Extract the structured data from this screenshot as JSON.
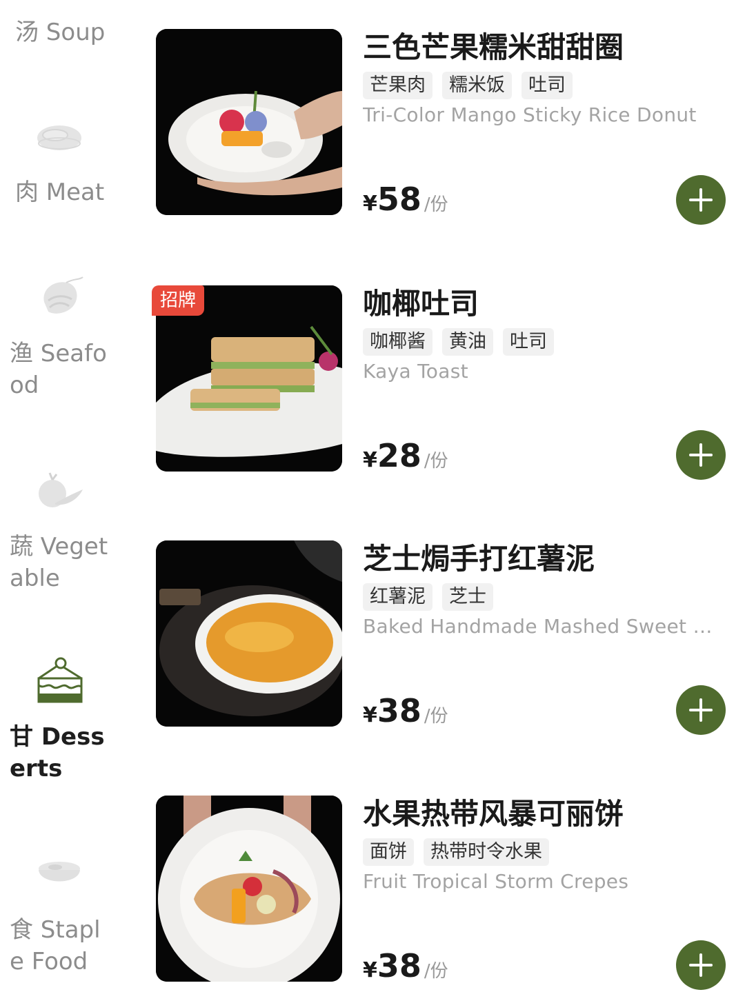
{
  "sidebar": {
    "categories": [
      {
        "label": "汤 Soup",
        "icon": "soup-icon",
        "active": false
      },
      {
        "label": "肉 Meat",
        "icon": "steak-icon",
        "active": false
      },
      {
        "label": "渔 Seafood",
        "icon": "shrimp-icon",
        "active": false
      },
      {
        "label": "蔬 Vegetable",
        "icon": "vegetable-icon",
        "active": false
      },
      {
        "label": "甘 Desserts",
        "icon": "cake-icon",
        "active": true
      },
      {
        "label": "食 Staple Food",
        "icon": "bowl-icon",
        "active": false
      }
    ]
  },
  "menu": {
    "items": [
      {
        "name": "三色芒果糯米甜甜圈",
        "tags": [
          "芒果肉",
          "糯米饭",
          "吐司"
        ],
        "english": "Tri-Color Mango Sticky Rice Donut",
        "currency": "¥",
        "price": "58",
        "unit": "/份",
        "badge": ""
      },
      {
        "name": "咖椰吐司",
        "tags": [
          "咖椰酱",
          "黄油",
          "吐司"
        ],
        "english": "Kaya Toast",
        "currency": "¥",
        "price": "28",
        "unit": "/份",
        "badge": "招牌"
      },
      {
        "name": "芝士焗手打红薯泥",
        "tags": [
          "红薯泥",
          "芝士"
        ],
        "english": "Baked Handmade Mashed Sweet Po...",
        "currency": "¥",
        "price": "38",
        "unit": "/份",
        "badge": ""
      },
      {
        "name": "水果热带风暴可丽饼",
        "tags": [
          "面饼",
          "热带时令水果"
        ],
        "english": "Fruit Tropical Storm Crepes",
        "currency": "¥",
        "price": "38",
        "unit": "/份",
        "badge": ""
      }
    ]
  },
  "colors": {
    "accent": "#4f6b2e",
    "badge": "#e8493a",
    "muted": "#a3a3a3"
  }
}
